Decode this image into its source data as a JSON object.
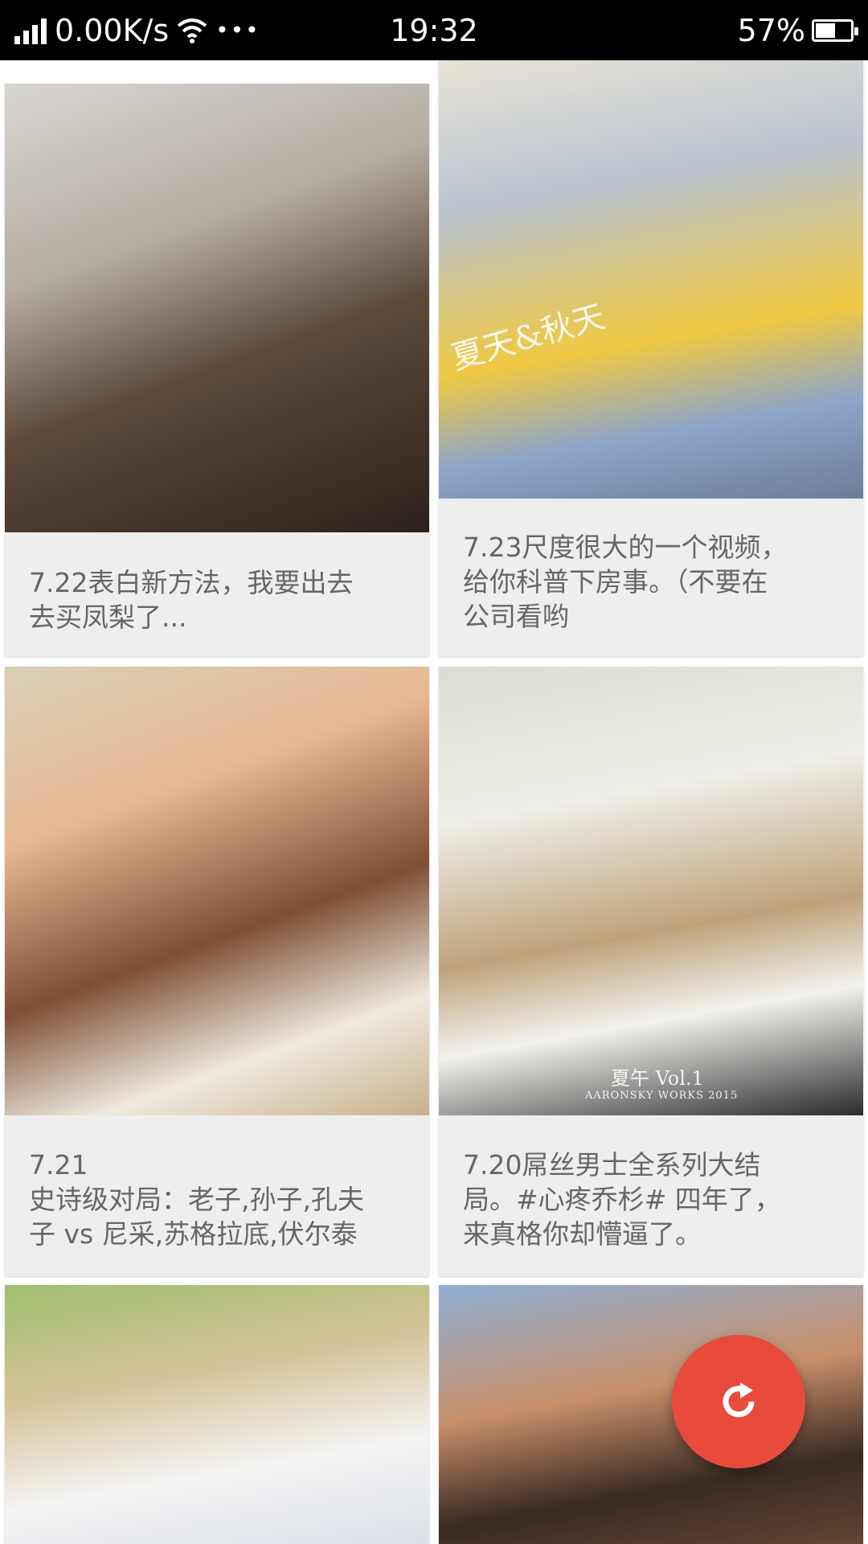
{
  "status_bar": {
    "network_speed": "0.00K/s",
    "more": "•••",
    "time": "19:32",
    "battery_percent": "57%",
    "battery_level": 0.57
  },
  "feed": {
    "cards": [
      {
        "caption": "7.22表白新方法，我要出去\n去买凤梨了..."
      },
      {
        "caption": "7.23尺度很大的一个视频，\n给你科普下房事。（不要在\n公司看哟",
        "photo_text": "夏天&秋天"
      },
      {
        "caption": "7.21\n史诗级对局：老子,孙子,孔夫\n子 vs  尼采,苏格拉底,伏尔泰"
      },
      {
        "caption": "7.20屌丝男士全系列大结\n局。#心疼乔杉# 四年了，\n来真格你却懵逼了。",
        "photo_text_title": "夏午 Vol.1",
        "photo_text_sub": "AARONSKY WORKS 2015"
      },
      {
        "caption": ""
      },
      {
        "caption": ""
      }
    ]
  },
  "fab": {
    "icon": "refresh-icon",
    "color": "#e84b3c"
  }
}
